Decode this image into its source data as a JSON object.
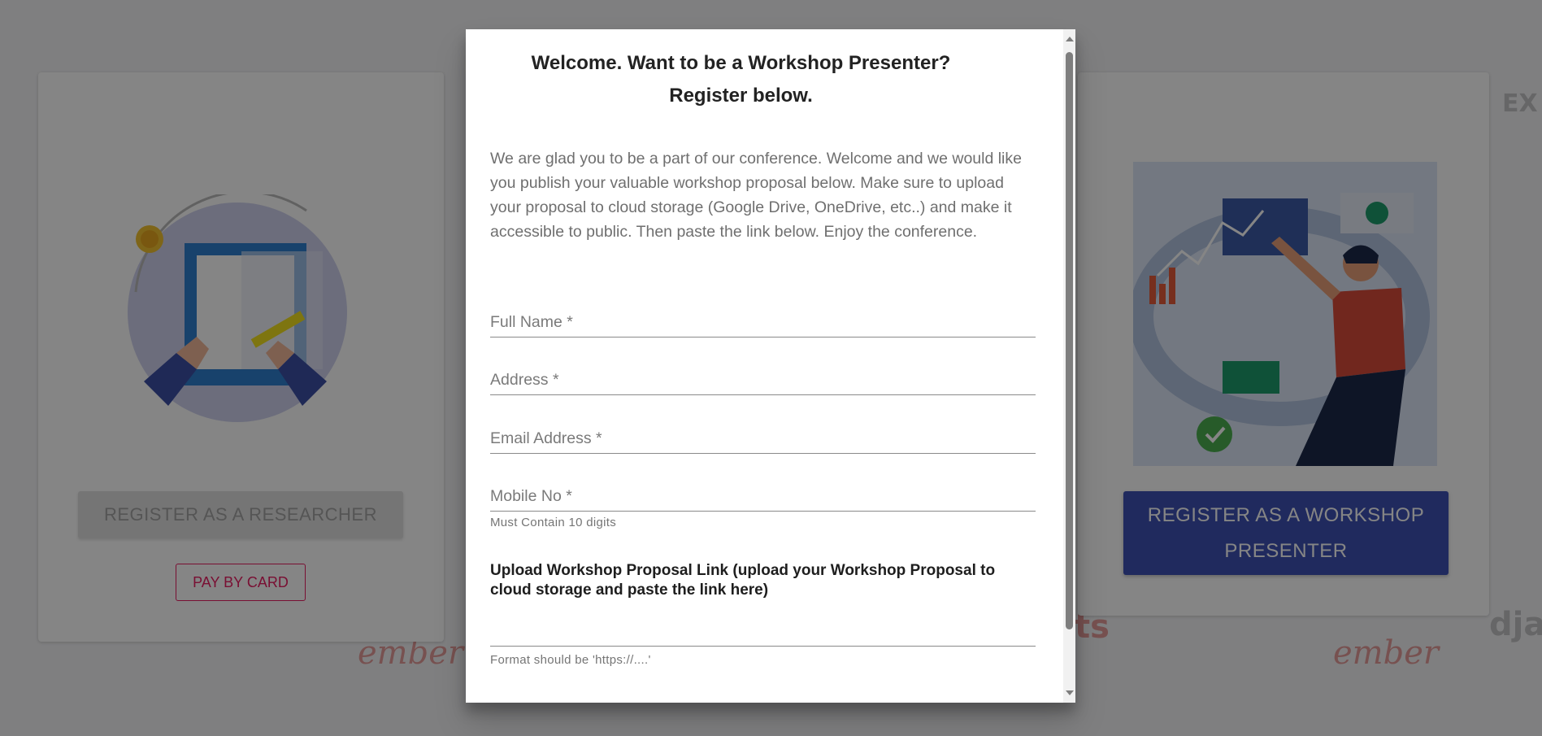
{
  "background": {
    "left_card": {
      "register_researcher_label": "REGISTER AS A RESEARCHER",
      "pay_by_card_label": "PAY BY CARD"
    },
    "right_card": {
      "register_workshop_label": "REGISTER AS A WORKSHOP PRESENTER"
    },
    "decorations": [
      "ember",
      "ember",
      "EX",
      "dja",
      "ts"
    ]
  },
  "dialog": {
    "title": "Welcome. Want to be a Workshop Presenter? Register below.",
    "intro": "We are glad you to be a part of our conference. Welcome and we would like you publish your valuable workshop proposal below. Make sure to upload your proposal to cloud storage (Google Drive, OneDrive, etc..) and make it accessible to public. Then paste the link below. Enjoy the conference.",
    "fields": {
      "full_name": {
        "label": "Full Name *"
      },
      "address": {
        "label": "Address *"
      },
      "email": {
        "label": "Email Address *"
      },
      "mobile": {
        "label": "Mobile No *",
        "helper": "Must Contain 10 digits"
      },
      "upload_link": {
        "label": "Upload Workshop Proposal Link (upload your Workshop Proposal to cloud storage and paste the link here)",
        "helper": "Format should be 'https://....'"
      }
    }
  },
  "colors": {
    "primary": "#3f51b5",
    "accent": "#e91e63",
    "overlay": "rgba(0,0,0,0.48)"
  }
}
